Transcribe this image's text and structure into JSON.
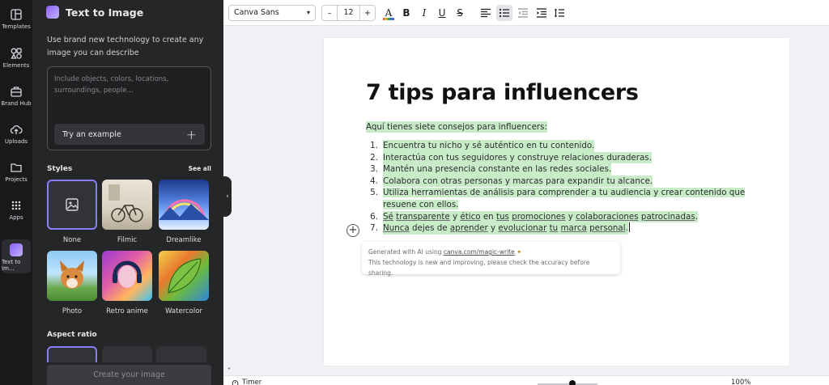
{
  "rail": {
    "items": [
      {
        "label": "Templates"
      },
      {
        "label": "Elements"
      },
      {
        "label": "Brand Hub"
      },
      {
        "label": "Uploads"
      },
      {
        "label": "Projects"
      },
      {
        "label": "Apps"
      },
      {
        "label": "Text to Im..."
      }
    ]
  },
  "panel": {
    "title": "Text to Image",
    "description": "Use brand new technology to create any image you can describe",
    "prompt_placeholder": "Include objects, colors, locations, surroundings, people...",
    "example_button": "Try an example",
    "styles_heading": "Styles",
    "see_all": "See all",
    "styles": [
      {
        "label": "None"
      },
      {
        "label": "Filmic"
      },
      {
        "label": "Dreamlike"
      },
      {
        "label": "Photo"
      },
      {
        "label": "Retro anime"
      },
      {
        "label": "Watercolor"
      }
    ],
    "aspect_heading": "Aspect ratio",
    "create_button": "Create your image"
  },
  "toolbar": {
    "font_family": "Canva Sans",
    "font_size": "12",
    "minus": "–",
    "plus": "+",
    "bold": "B",
    "italic": "I",
    "underline": "U",
    "strike": "S",
    "text_color_letter": "A"
  },
  "document": {
    "title": "7 tips para influencers",
    "intro": "Aquí tienes siete consejos para influencers:",
    "tips": [
      {
        "num": "1.",
        "text": "Encuentra tu nicho y sé auténtico en tu contenido."
      },
      {
        "num": "2.",
        "text": "Interactúa con tus seguidores y construye relaciones duraderas."
      },
      {
        "num": "3.",
        "text": "Mantén una presencia constante en las redes sociales."
      },
      {
        "num": "4.",
        "text": "Colabora con otras personas y marcas para expandir tu alcance."
      },
      {
        "num": "5.",
        "text_line1": "Utiliza herramientas de análisis para comprender a tu audiencia y crear contenido que",
        "text_line2": "resuene con ellos."
      },
      {
        "num": "6.",
        "parts": [
          "Sé",
          " ",
          "transparente",
          " y ",
          "ético",
          " en ",
          "tus",
          " ",
          "promociones",
          " y ",
          "colaboraciones",
          " ",
          "patrocinadas",
          "."
        ]
      },
      {
        "num": "7.",
        "parts": [
          "Nunca",
          " dejes de ",
          "aprender",
          " y ",
          "evolucionar",
          " ",
          "tu",
          " ",
          "marca",
          " ",
          "personal",
          "."
        ]
      }
    ]
  },
  "ai_note": {
    "prefix": "Generated with AI using ",
    "link": "canva.com/magic-write",
    "line2": "This technology is new and improving, please check the accuracy before sharing."
  },
  "bottom": {
    "timer": "Timer",
    "zoom": "100%"
  }
}
